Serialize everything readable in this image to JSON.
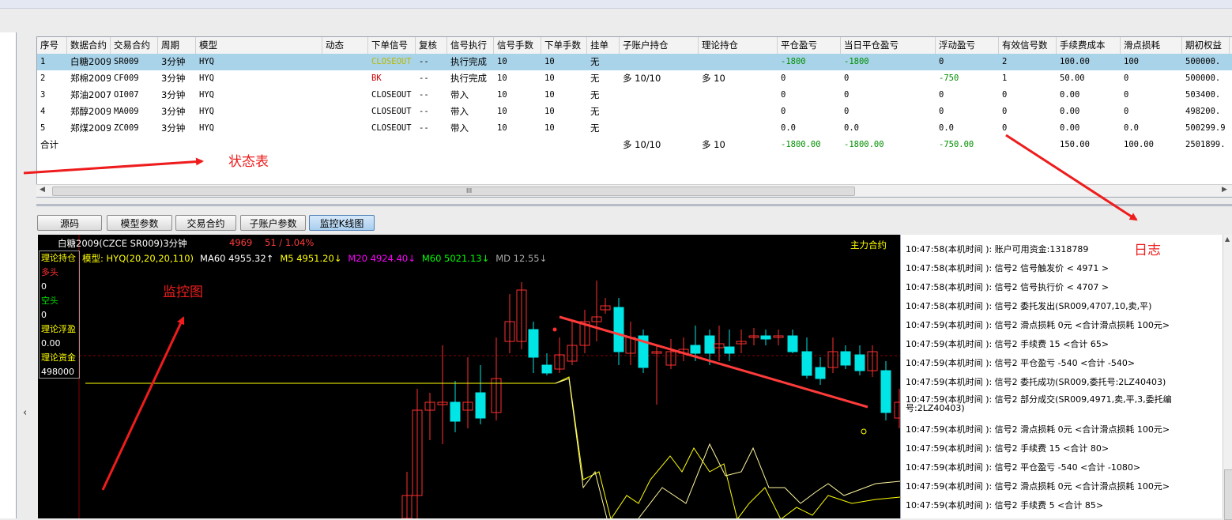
{
  "table": {
    "columns": [
      {
        "label": "序号",
        "w": 38
      },
      {
        "label": "数据合约",
        "w": 55
      },
      {
        "label": "交易合约",
        "w": 60
      },
      {
        "label": "周期",
        "w": 48
      },
      {
        "label": "模型",
        "w": 160
      },
      {
        "label": "动态",
        "w": 58
      },
      {
        "label": "下单信号",
        "w": 60
      },
      {
        "label": "复核",
        "w": 40
      },
      {
        "label": "信号执行",
        "w": 59
      },
      {
        "label": "信号手数",
        "w": 60
      },
      {
        "label": "下单手数",
        "w": 58
      },
      {
        "label": "挂单",
        "w": 41
      },
      {
        "label": "子账户持仓",
        "w": 100
      },
      {
        "label": "理论持仓",
        "w": 100
      },
      {
        "label": "平仓盈亏",
        "w": 80
      },
      {
        "label": "当日平仓盈亏",
        "w": 120
      },
      {
        "label": "浮动盈亏",
        "w": 80
      },
      {
        "label": "有效信号数",
        "w": 73
      },
      {
        "label": "手续费成本",
        "w": 81
      },
      {
        "label": "滑点损耗",
        "w": 78
      },
      {
        "label": "期初权益",
        "w": 60
      }
    ],
    "rows": [
      {
        "selected": true,
        "cells": [
          "1",
          "白糖2009",
          "SR009",
          "3分钟",
          "HYQ",
          "",
          "CLOSEOUT",
          "--",
          "执行完成",
          "10",
          "10",
          "无",
          "",
          "",
          "-1800",
          "-1800",
          "0",
          "2",
          "100.00",
          "100",
          "500000."
        ]
      },
      {
        "selected": false,
        "cells": [
          "2",
          "郑棉2009",
          "CF009",
          "3分钟",
          "HYQ",
          "",
          "BK",
          "--",
          "执行完成",
          "10",
          "10",
          "无",
          "多 10/10",
          "多 10",
          "0",
          "0",
          "-750",
          "1",
          "50.00",
          "0",
          "500000."
        ]
      },
      {
        "selected": false,
        "cells": [
          "3",
          "郑油2007",
          "OI007",
          "3分钟",
          "HYQ",
          "",
          "CLOSEOUT",
          "--",
          "带入",
          "10",
          "10",
          "无",
          "",
          "",
          "0",
          "0",
          "0",
          "0",
          "0.00",
          "0",
          "503400."
        ]
      },
      {
        "selected": false,
        "cells": [
          "4",
          "郑醇2009",
          "MA009",
          "3分钟",
          "HYQ",
          "",
          "CLOSEOUT",
          "--",
          "带入",
          "10",
          "10",
          "无",
          "",
          "",
          "0",
          "0",
          "0",
          "0",
          "0.00",
          "0",
          "498200."
        ]
      },
      {
        "selected": false,
        "cells": [
          "5",
          "郑煤2009",
          "ZC009",
          "3分钟",
          "HYQ",
          "",
          "CLOSEOUT",
          "--",
          "带入",
          "10",
          "10",
          "无",
          "",
          "",
          "0.0",
          "0.0",
          "0.0",
          "0",
          "0.00",
          "0.0",
          "500299.9"
        ]
      }
    ],
    "total": {
      "label": "合计",
      "sub_pos": "多 10/10",
      "theo_pos": "多 10",
      "close_pnl": "-1800.00",
      "day_close_pnl": "-1800.00",
      "float_pnl": "-750.00",
      "fee": "150.00",
      "slip": "100.00",
      "equity": "2501899."
    },
    "scroll_grip": "III"
  },
  "tabs": [
    {
      "label": "源码",
      "active": false
    },
    {
      "label": "模型参数",
      "active": false
    },
    {
      "label": "交易合约",
      "active": false
    },
    {
      "label": "子账户参数",
      "active": false
    },
    {
      "label": "监控K线图",
      "active": true
    }
  ],
  "chart": {
    "title": "白糖2009(CZCE SR009)3分钟",
    "price": "4969",
    "change": "51 / 1.04%",
    "main_contract": "主力合约",
    "indicators": [
      {
        "text": "模型: HYQ(20,20,20,110)",
        "color": "#ffff00"
      },
      {
        "text": "MA60 4955.32↑",
        "color": "#ffffff"
      },
      {
        "text": "M5 4951.20↓",
        "color": "#ffff00"
      },
      {
        "text": "M20 4924.40↓",
        "color": "#ff00ff"
      },
      {
        "text": "M60 5021.13↓",
        "color": "#00ff00"
      },
      {
        "text": "MD 12.55↓",
        "color": "#aaaaaa"
      }
    ],
    "info": [
      {
        "text": "理论持仓",
        "color": "#ffff00"
      },
      {
        "text": "多头",
        "color": "#ff3030"
      },
      {
        "text": "0",
        "color": "#ffffff"
      },
      {
        "text": "空头",
        "color": "#00e000"
      },
      {
        "text": "0",
        "color": "#ffffff"
      },
      {
        "text": "理论浮盈",
        "color": "#ffff00"
      },
      {
        "text": "0.00",
        "color": "#ffffff"
      },
      {
        "text": "理论资金",
        "color": "#ffff00"
      },
      {
        "text": "498000",
        "color": "#ffffff"
      }
    ],
    "up_color": "#ff3030",
    "down_color": "#00e5e5"
  },
  "log": [
    "10:47:58(本机时间    ): 账户可用资金:1318789",
    "10:47:58(本机时间    ): 信号2 信号触发价 < 4971 >",
    "10:47:58(本机时间    ): 信号2 信号执行价 < 4707 >",
    "10:47:58(本机时间    ): 信号2 委托发出(SR009,4707,10,卖,平)",
    "10:47:59(本机时间    ): 信号2 滑点损耗 0元 <合计滑点损耗 100元>",
    "10:47:59(本机时间    ): 信号2 手续费 15 <合计 65>",
    "10:47:59(本机时间    ): 信号2 平仓盈亏 -540 <合计 -540>",
    "10:47:59(本机时间    ): 信号2 委托成功(SR009,委托号:2LZ40403)",
    "10:47:59(本机时间    ): 信号2 部分成交(SR009,4971,卖,平,3,委托编号:2LZ40403)",
    "10:47:59(本机时间    ): 信号2 滑点损耗 0元 <合计滑点损耗 100元>",
    "10:47:59(本机时间    ): 信号2 手续费 15 <合计 80>",
    "10:47:59(本机时间    ): 信号2 平仓盈亏 -540 <合计 -1080>",
    "10:47:59(本机时间    ): 信号2 滑点损耗 0元 <合计滑点损耗 100元>",
    "10:47:59(本机时间    ): 信号2 手续费 5 <合计 85>"
  ],
  "annotations": {
    "status_table": "状态表",
    "log": "日志",
    "monitor_chart": "监控图",
    "color": "#ee1c1c"
  },
  "colors": {
    "green_value": "#008f00",
    "yellow_signal": "#b8b800",
    "red_signal": "#d00000"
  }
}
